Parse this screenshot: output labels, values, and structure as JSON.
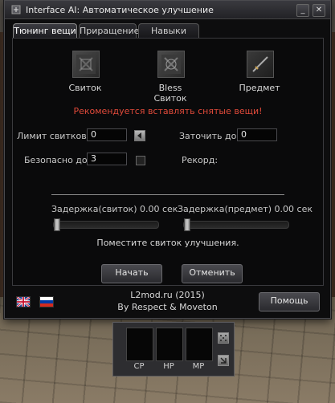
{
  "window": {
    "title": "Interface AI: Автоматическое улучшение",
    "minimize_label": "_",
    "close_label": "✕"
  },
  "tabs": [
    {
      "label": "Тюнинг вещи",
      "active": true
    },
    {
      "label": "Приращение",
      "active": false
    },
    {
      "label": "Навыки",
      "active": false
    }
  ],
  "slots": {
    "scroll_label": "Свиток",
    "bless_label_line1": "Bless",
    "bless_label_line2": "Свиток",
    "item_label": "Предмет"
  },
  "warning": "Рекомендуется вставлять снятые вещи!",
  "form": {
    "scroll_limit_label": "Лимит свитков:",
    "scroll_limit_value": "0",
    "enchant_to_label": "Заточить до:",
    "enchant_to_value": "0",
    "safe_to_label": "Безопасно до:",
    "safe_to_value": "3",
    "record_label": "Рекорд:"
  },
  "delays": {
    "scroll_label": "Задержка(свиток) 0.00 сек",
    "item_label": "Задержка(предмет) 0.00 сек",
    "scroll_level": 0,
    "item_level": 0
  },
  "status": "Поместите свиток улучшения.",
  "buttons": {
    "start": "Начать",
    "cancel": "Отменить",
    "help": "Помощь"
  },
  "footer": {
    "line1": "L2mod.ru (2015)",
    "line2": "By Respect & Moveton"
  },
  "hud": {
    "cp": "CP",
    "hp": "HP",
    "mp": "MP"
  }
}
